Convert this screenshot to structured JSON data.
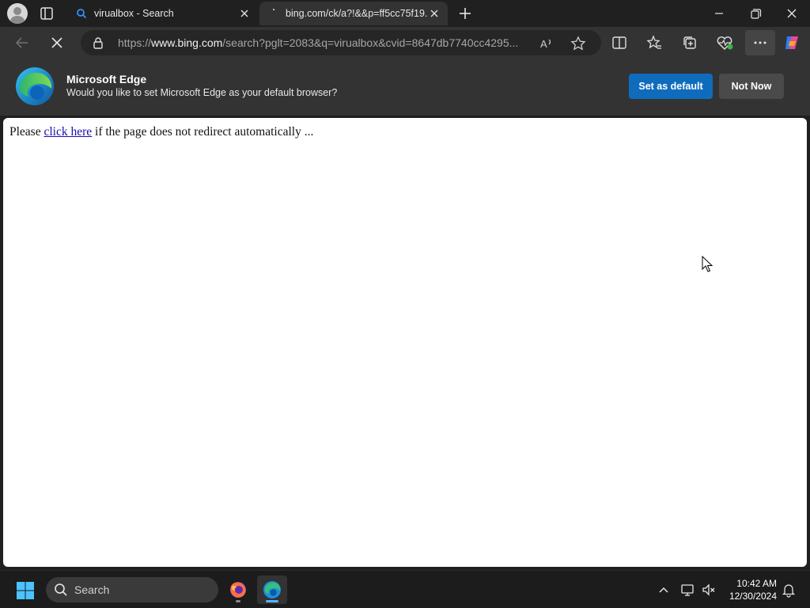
{
  "tabs": [
    {
      "title": "virualbox - Search",
      "active": false
    },
    {
      "title": "bing.com/ck/a?!&&p=ff5cc75f19...",
      "active": true
    }
  ],
  "address": {
    "url_prefix": "https://",
    "url_domain": "www.bing.com",
    "url_rest": "/search?pglt=2083&q=virualbox&cvid=8647db7740cc4295..."
  },
  "infobar": {
    "title": "Microsoft Edge",
    "message": "Would you like to set Microsoft Edge as your default browser?",
    "set_default_label": "Set as default",
    "not_now_label": "Not Now"
  },
  "page": {
    "text_before": "Please ",
    "link_text": "click here",
    "text_after": " if the page does not redirect automatically ..."
  },
  "taskbar": {
    "search_label": "Search",
    "time": "10:42 AM",
    "date": "12/30/2024"
  },
  "colors": {
    "accent": "#0f6cbd",
    "link": "#1a0dab",
    "chrome_bg": "#202020",
    "toolbar_bg": "#333333"
  }
}
